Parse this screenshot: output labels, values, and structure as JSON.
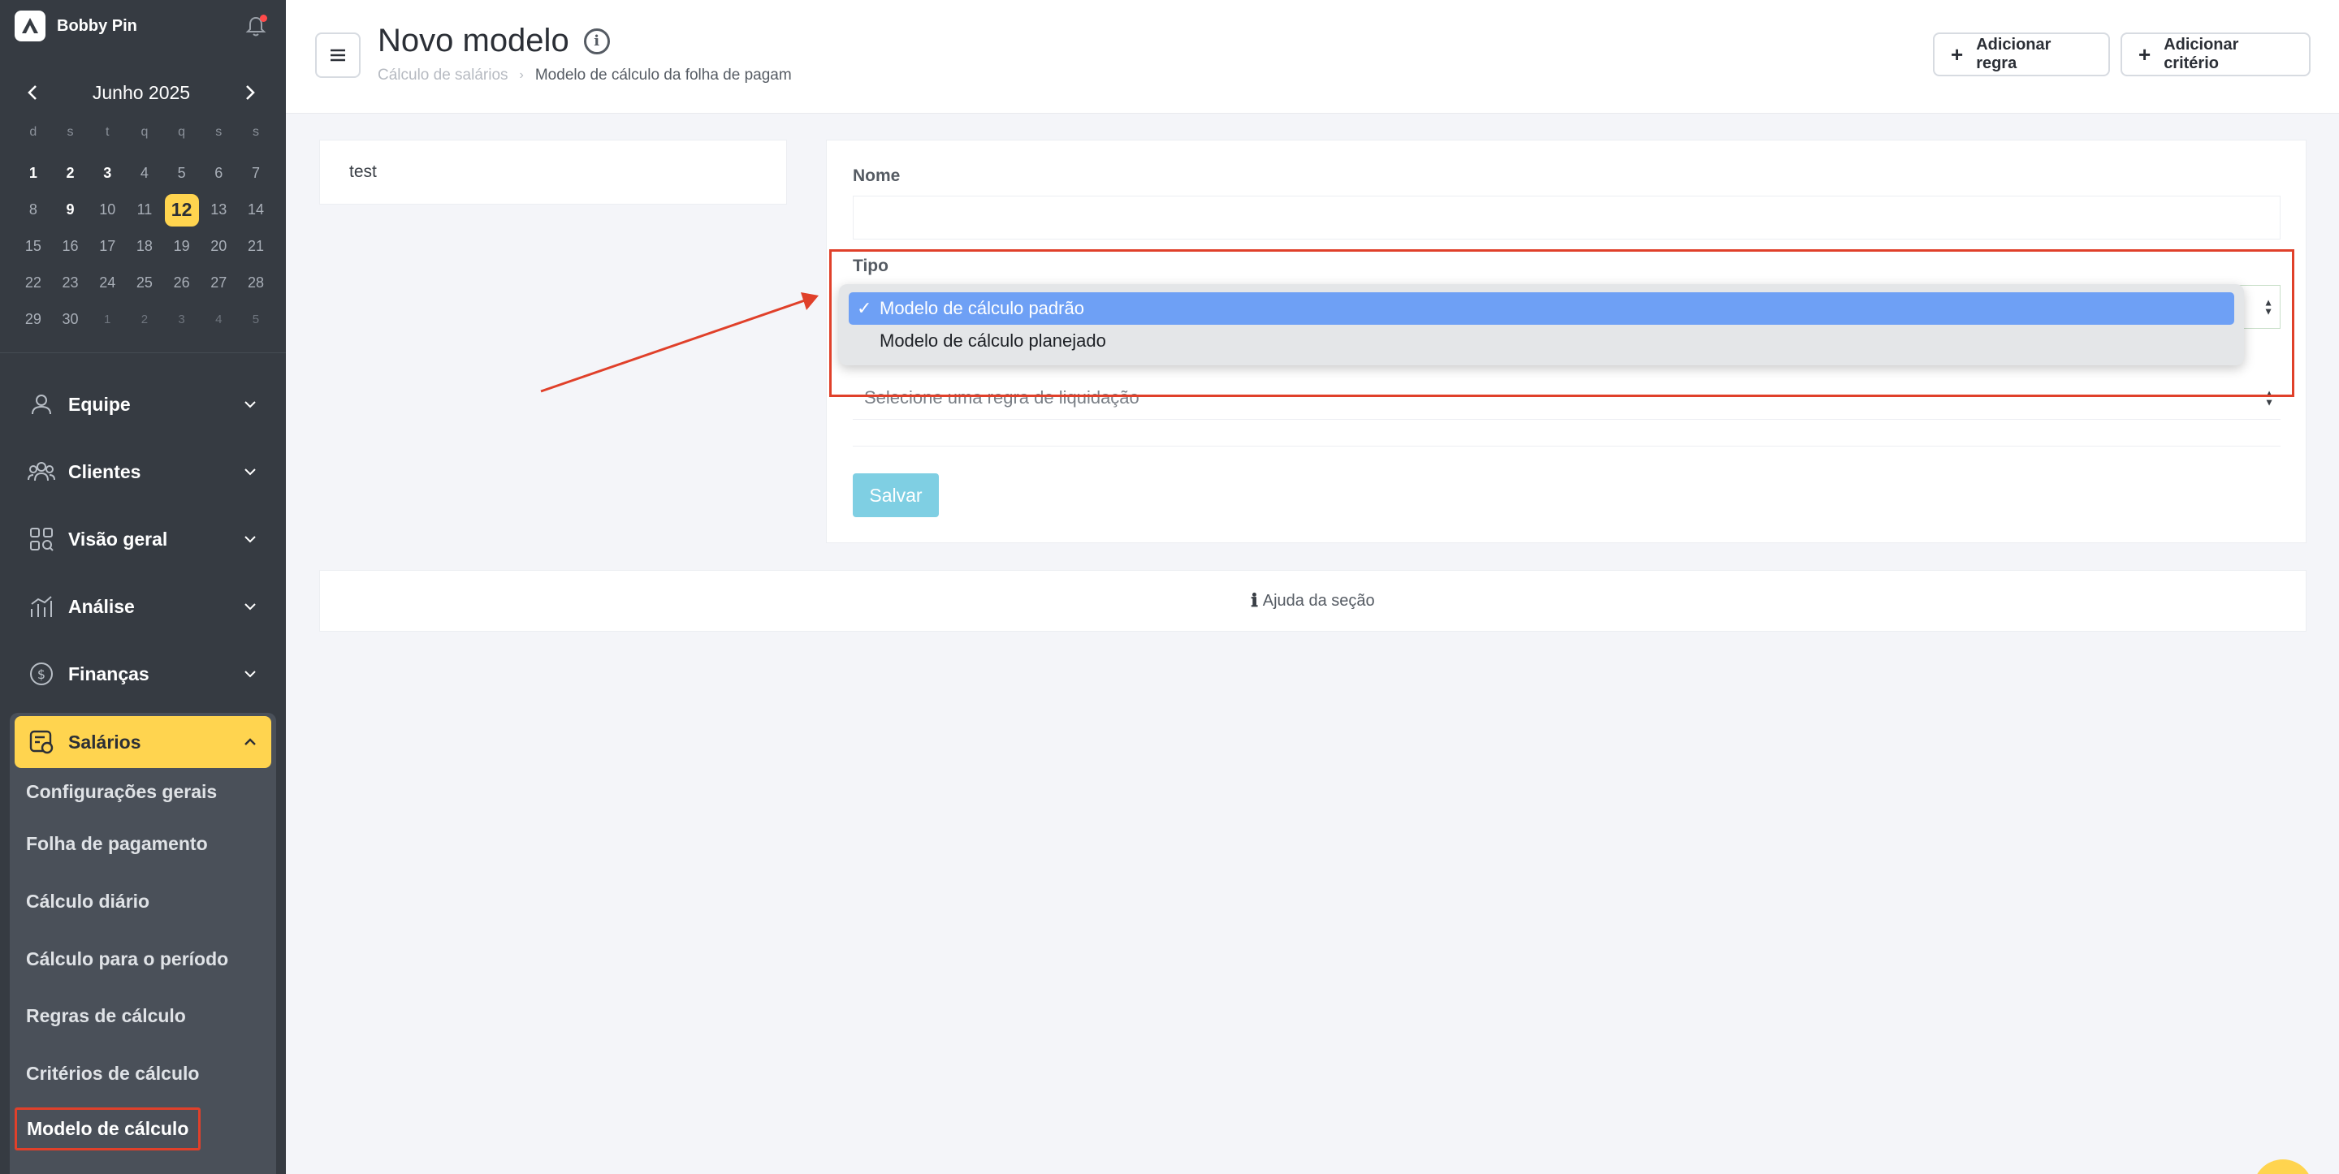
{
  "brand": {
    "name": "Bobby Pin"
  },
  "calendar": {
    "month_label": "Junho 2025",
    "weekdays": [
      "d",
      "s",
      "t",
      "q",
      "q",
      "s",
      "s"
    ],
    "weeks": [
      [
        "1",
        "2",
        "3",
        "4",
        "5",
        "6",
        "7"
      ],
      [
        "8",
        "9",
        "10",
        "11",
        "12",
        "13",
        "14"
      ],
      [
        "15",
        "16",
        "17",
        "18",
        "19",
        "20",
        "21"
      ],
      [
        "22",
        "23",
        "24",
        "25",
        "26",
        "27",
        "28"
      ],
      [
        "29",
        "30",
        "1",
        "2",
        "3",
        "4",
        "5"
      ]
    ],
    "today": "12"
  },
  "sidebar": {
    "items": [
      {
        "label": "Equipe",
        "icon": "person-icon"
      },
      {
        "label": "Clientes",
        "icon": "people-icon"
      },
      {
        "label": "Visão geral",
        "icon": "grid-search-icon"
      },
      {
        "label": "Análise",
        "icon": "analytics-icon"
      },
      {
        "label": "Finanças",
        "icon": "dollar-circle-icon"
      },
      {
        "label": "Salários",
        "icon": "payroll-icon"
      }
    ],
    "salarios_sub": [
      "Configurações gerais",
      "Folha de pagamento",
      "Cálculo diário",
      "Cálculo para o período",
      "Regras de cálculo",
      "Critérios de cálculo",
      "Modelo de cálculo"
    ]
  },
  "header": {
    "title": "Novo modelo",
    "breadcrumb": [
      "Cálculo de salários",
      "Modelo de cálculo da folha de pagam"
    ],
    "btn_add_rule": "Adicionar regra",
    "btn_add_criteria": "Adicionar critério"
  },
  "list": {
    "items": [
      "test"
    ]
  },
  "form": {
    "name_label": "Nome",
    "type_label": "Tipo",
    "rule_placeholder": "Selecione uma regra de liquidação",
    "save_label": "Salvar"
  },
  "dropdown": {
    "options": [
      "Modelo de cálculo padrão",
      "Modelo de cálculo planejado"
    ],
    "selected_index": 0,
    "check_glyph": "✓"
  },
  "help": {
    "label": "Ajuda da seção"
  },
  "colors": {
    "accent_yellow": "#ffd44f",
    "sidebar_bg": "#363b42",
    "annotation_red": "#e0402a",
    "select_blue": "#6ea0f5",
    "save_button": "#7fcfe3"
  }
}
